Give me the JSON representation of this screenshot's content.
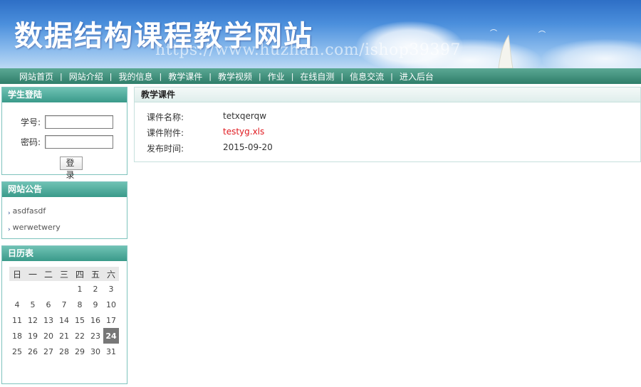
{
  "header": {
    "site_title": "数据结构课程教学网站",
    "watermark": "https://www.huzhan.com/ishop39397"
  },
  "nav": {
    "items": [
      "网站首页",
      "网站介绍",
      "我的信息",
      "教学课件",
      "教学视频",
      "作业",
      "在线自测",
      "信息交流",
      "进入后台"
    ],
    "separator": "|"
  },
  "login": {
    "title": "学生登陆",
    "student_id_label": "学号:",
    "student_id_value": "",
    "password_label": "密码:",
    "password_value": "",
    "submit_label": "登 录"
  },
  "notice": {
    "title": "网站公告",
    "items": [
      "asdfasdf",
      "werwetwery"
    ]
  },
  "calendar": {
    "title": "日历表",
    "weekdays": [
      "日",
      "一",
      "二",
      "三",
      "四",
      "五",
      "六"
    ],
    "weeks": [
      [
        "",
        "",
        "",
        "",
        "1",
        "2",
        "3"
      ],
      [
        "4",
        "5",
        "6",
        "7",
        "8",
        "9",
        "10"
      ],
      [
        "11",
        "12",
        "13",
        "14",
        "15",
        "16",
        "17"
      ],
      [
        "18",
        "19",
        "20",
        "21",
        "22",
        "23",
        "24"
      ],
      [
        "25",
        "26",
        "27",
        "28",
        "29",
        "30",
        "31"
      ]
    ],
    "today": "24"
  },
  "courseware": {
    "section_title": "教学课件",
    "name_label": "课件名称:",
    "name_value": "tetxqerqw",
    "attachment_label": "课件附件:",
    "attachment_value": "testyg.xls",
    "date_label": "发布时间:",
    "date_value": "2015-09-20"
  },
  "colors": {
    "nav_bg": "#2f7e6a",
    "panel_header": "#3a9a8a",
    "attachment_link": "#e0191f",
    "today_bg": "#777777"
  }
}
